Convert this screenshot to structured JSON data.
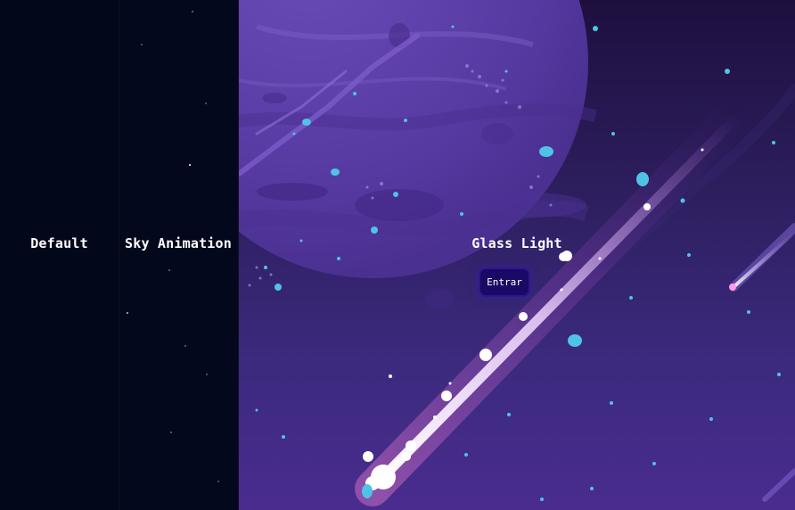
{
  "panels": {
    "default": {
      "title": "Default"
    },
    "sky": {
      "title": "Sky Animation"
    },
    "glass": {
      "title": "Glass Light",
      "button_label": "Entrar"
    }
  },
  "colors": {
    "background_dark": "#03071a",
    "planet": "#5b3fa8",
    "sky_gradient_top": "#1e0f3e",
    "sky_gradient_bottom": "#4a2c8f",
    "button_bg": "#1a0a66",
    "particle_cyan": "#4fc3e6",
    "meteor_glow": "#e9c8ff"
  },
  "icons": [
    "planet-graphic",
    "meteor-graphic",
    "star-particles"
  ]
}
